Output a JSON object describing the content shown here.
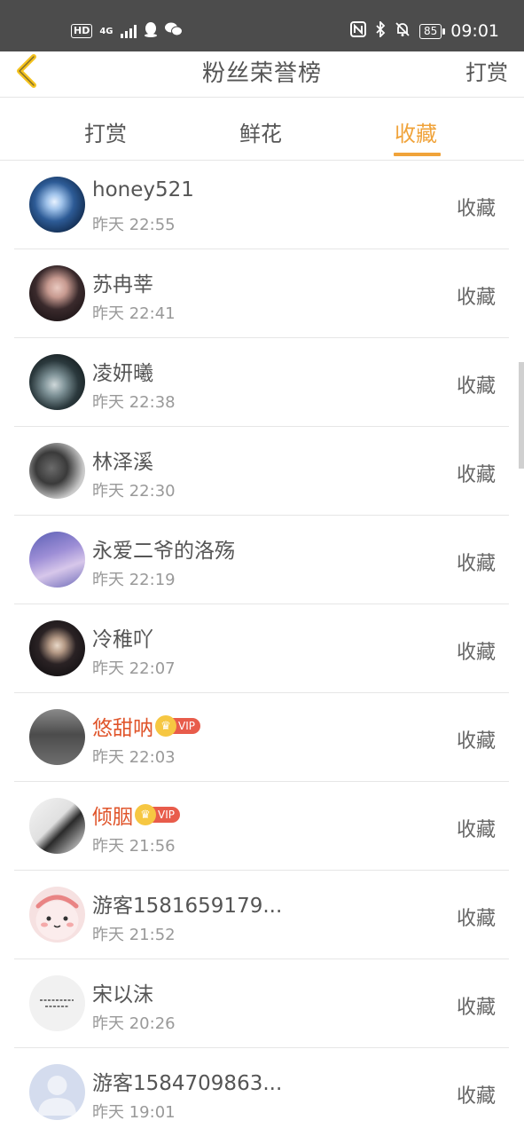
{
  "status_bar": {
    "hd": "HD",
    "network": "4G",
    "battery": "85",
    "time": "09:01"
  },
  "header": {
    "title": "粉丝荣誉榜",
    "action": "打赏"
  },
  "tabs": [
    {
      "label": "打赏",
      "active": false
    },
    {
      "label": "鲜花",
      "active": false
    },
    {
      "label": "收藏",
      "active": true
    }
  ],
  "colors": {
    "accent": "#f0a33a",
    "vip_name": "#e0552b",
    "status_bar": "#4c4c4c"
  },
  "fans": [
    {
      "name": "honey521",
      "time": "昨天 22:55",
      "action": "收藏",
      "vip": false
    },
    {
      "name": "苏冉莘",
      "time": "昨天 22:41",
      "action": "收藏",
      "vip": false
    },
    {
      "name": "凌妍曦",
      "time": "昨天 22:38",
      "action": "收藏",
      "vip": false
    },
    {
      "name": "林泽溪",
      "time": "昨天 22:30",
      "action": "收藏",
      "vip": false
    },
    {
      "name": "永爱二爷的洛殇",
      "time": "昨天 22:19",
      "action": "收藏",
      "vip": false
    },
    {
      "name": "冷稚吖",
      "time": "昨天 22:07",
      "action": "收藏",
      "vip": false
    },
    {
      "name": "悠甜呐",
      "time": "昨天 22:03",
      "action": "收藏",
      "vip": true,
      "badge": "VIP"
    },
    {
      "name": "倾胭",
      "time": "昨天 21:56",
      "action": "收藏",
      "vip": true,
      "badge": "VIP"
    },
    {
      "name": "游客1581659179...",
      "time": "昨天 21:52",
      "action": "收藏",
      "vip": false
    },
    {
      "name": "宋以沫",
      "time": "昨天 20:26",
      "action": "收藏",
      "vip": false
    },
    {
      "name": "游客1584709863...",
      "time": "昨天 19:01",
      "action": "收藏",
      "vip": false
    }
  ]
}
